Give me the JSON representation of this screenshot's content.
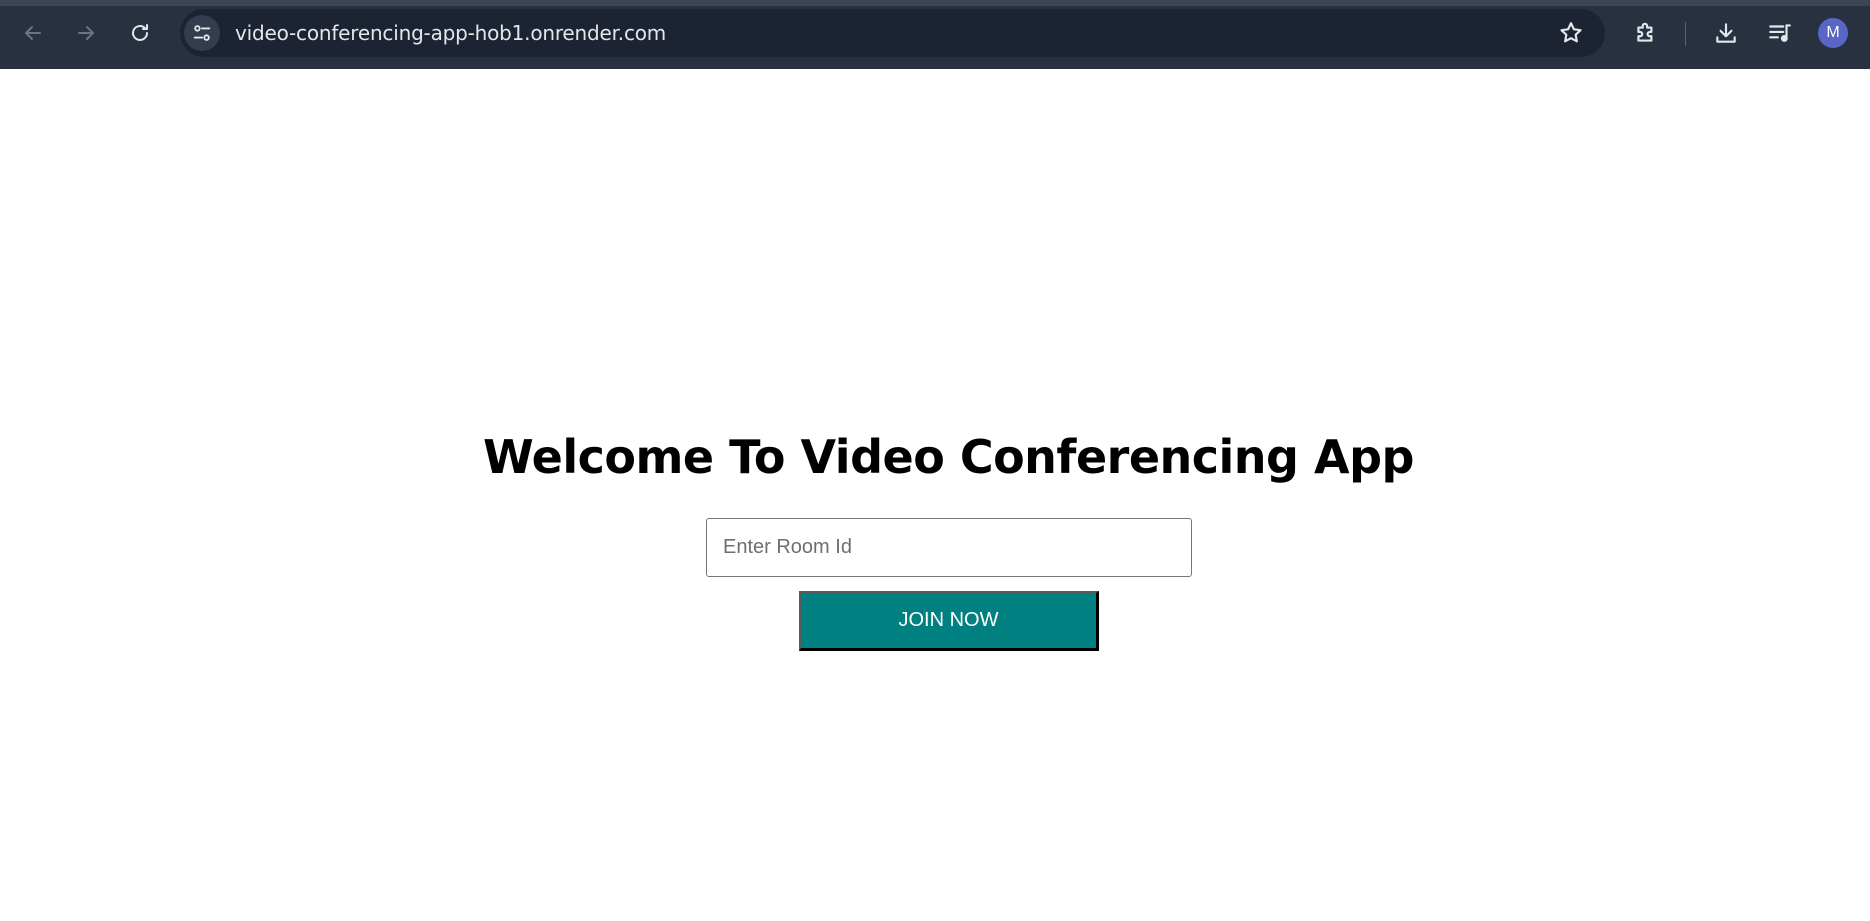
{
  "browser": {
    "url": "video-conferencing-app-hob1.onrender.com",
    "profile_initial": "M",
    "icons": {
      "back": "arrow-left-icon",
      "forward": "arrow-right-icon",
      "reload": "reload-icon",
      "site_info": "tune-icon",
      "bookmark": "star-icon",
      "extensions": "puzzle-icon",
      "downloads": "download-icon",
      "media": "playlist-music-icon"
    },
    "colors": {
      "toolbar": "#283140",
      "omnibox": "#1c2433",
      "avatar": "#5a65c8"
    }
  },
  "page": {
    "title": "Welcome To Video Conferencing App",
    "room_input": {
      "placeholder": "Enter Room Id",
      "value": ""
    },
    "join_button_label": "JOIN NOW",
    "colors": {
      "join_button": "#008080",
      "background": "#ffffff"
    }
  }
}
